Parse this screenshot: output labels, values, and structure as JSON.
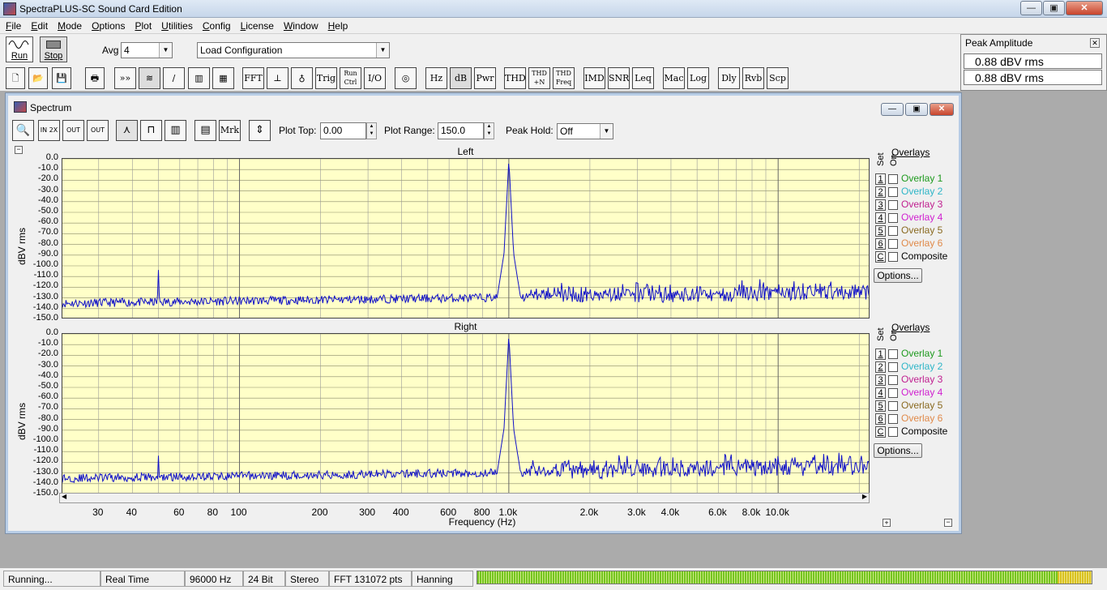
{
  "window": {
    "title": "SpectraPLUS-SC Sound Card Edition"
  },
  "menu": [
    "File",
    "Edit",
    "Mode",
    "Options",
    "Plot",
    "Utilities",
    "Config",
    "License",
    "Window",
    "Help"
  ],
  "toolbar": {
    "run_label": "Run",
    "stop_label": "Stop",
    "avg_label": "Avg",
    "avg_value": "4",
    "config_value": "Load Configuration",
    "buttons": [
      "FFT",
      "Trig",
      "Run Ctrl",
      "I/O",
      "Hz",
      "dB",
      "Pwr",
      "THD",
      "THD +N",
      "THD Freq",
      "IMD",
      "SNR",
      "Leq",
      "Mac",
      "Log",
      "Dly",
      "Rvb",
      "Scp"
    ]
  },
  "peak_amplitude": {
    "title": "Peak Amplitude",
    "values": [
      "0.88 dBV rms",
      "0.88 dBV rms"
    ]
  },
  "spectrum": {
    "title": "Spectrum",
    "plot_top_label": "Plot Top:",
    "plot_top_value": "0.00",
    "plot_range_label": "Plot Range:",
    "plot_range_value": "150.0",
    "peak_hold_label": "Peak Hold:",
    "peak_hold_value": "Off",
    "marker_label": "Mrk",
    "zoom_buttons": [
      "IN 2X",
      "OUT 2X",
      "OUT Full"
    ],
    "overlays_label": "Overlays",
    "set_label": "Set",
    "on_label": "On",
    "overlays": [
      {
        "num": "1",
        "name": "Overlay 1",
        "color": "#1e9a1e"
      },
      {
        "num": "2",
        "name": "Overlay 2",
        "color": "#2fb6c8"
      },
      {
        "num": "3",
        "name": "Overlay 3",
        "color": "#c02090"
      },
      {
        "num": "4",
        "name": "Overlay 4",
        "color": "#d020d0"
      },
      {
        "num": "5",
        "name": "Overlay 5",
        "color": "#8a6a20"
      },
      {
        "num": "6",
        "name": "Overlay 6",
        "color": "#e08a4a"
      },
      {
        "num": "C",
        "name": "Composite",
        "color": "#000000"
      }
    ],
    "options_label": "Options...",
    "xlabel": "Frequency (Hz)",
    "ylabel": "dBV rms"
  },
  "chart_data": [
    {
      "type": "line",
      "title": "Left",
      "xlabel": "Frequency (Hz)",
      "ylabel": "dBV rms",
      "xscale": "log",
      "xlim": [
        22,
        22000
      ],
      "ylim": [
        -150,
        0
      ],
      "yticks": [
        "0.0",
        "-10.0",
        "-20.0",
        "-30.0",
        "-40.0",
        "-50.0",
        "-60.0",
        "-70.0",
        "-80.0",
        "-90.0",
        "-100.0",
        "-110.0",
        "-120.0",
        "-130.0",
        "-140.0",
        "-150.0"
      ],
      "xticks": [
        "30",
        "40",
        "60",
        "80",
        "100",
        "200",
        "300",
        "400",
        "600",
        "800",
        "1.0k",
        "2.0k",
        "3.0k",
        "4.0k",
        "6.0k",
        "8.0k",
        "10.0k"
      ],
      "grid": true,
      "series": [
        {
          "values_note": "noise floor ~-135",
          "peaks": [
            {
              "x": 50,
              "y": -103
            },
            {
              "x": 1000,
              "y": 0
            },
            {
              "x": 3000,
              "y": -118
            },
            {
              "x": 5000,
              "y": -118
            },
            {
              "x": 7000,
              "y": -118
            },
            {
              "x": 9000,
              "y": -118
            }
          ]
        }
      ]
    },
    {
      "type": "line",
      "title": "Right",
      "xlabel": "Frequency (Hz)",
      "ylabel": "dBV rms",
      "xscale": "log",
      "xlim": [
        22,
        22000
      ],
      "ylim": [
        -150,
        0
      ],
      "grid": true,
      "series": [
        {
          "peaks": [
            {
              "x": 50,
              "y": -113
            },
            {
              "x": 1000,
              "y": 0
            },
            {
              "x": 3000,
              "y": -107
            },
            {
              "x": 5000,
              "y": -118
            },
            {
              "x": 9000,
              "y": -118
            }
          ]
        }
      ]
    }
  ],
  "status": {
    "state": "Running...",
    "mode": "Real Time",
    "rate": "96000 Hz",
    "bits": "24 Bit",
    "channels": "Stereo",
    "fft": "FFT 131072 pts",
    "window": "Hanning"
  }
}
